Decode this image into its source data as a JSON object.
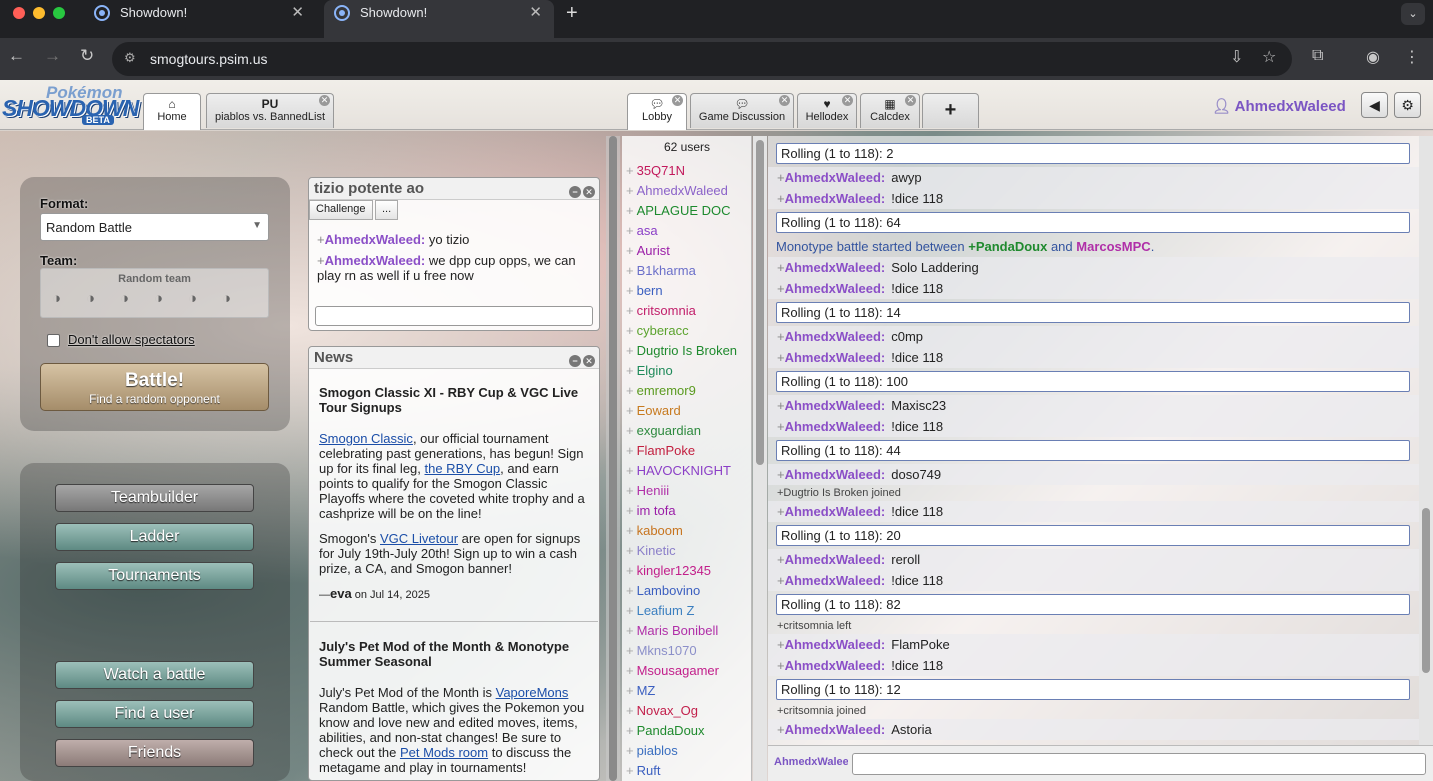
{
  "browser": {
    "tabs": [
      {
        "title": "Showdown!",
        "close": "✕"
      },
      {
        "title": "Showdown!",
        "close": "✕"
      }
    ],
    "new_tab": "+",
    "url": "smogtours.psim.us"
  },
  "header": {
    "logo": {
      "line1": "Pokémon",
      "line2": "SHOWDOWN",
      "badge": "BETA"
    },
    "tabs": [
      {
        "icon": "⌂",
        "label": "Home"
      },
      {
        "title": "PU",
        "label": "piablos vs. BannedList"
      },
      {
        "label": "Lobby"
      },
      {
        "label": "Game Discussion"
      },
      {
        "label": "Hellodex"
      },
      {
        "label": "Calcdex"
      }
    ],
    "add_tab": "+",
    "username": "AhmedxWaleed"
  },
  "mainmenu": {
    "format_label": "Format:",
    "format_value": "Random Battle",
    "team_label": "Team:",
    "team_value": "Random team",
    "spectators_label": "Don't allow spectators",
    "battle_title": "Battle!",
    "battle_sub": "Find a random opponent",
    "buttons": [
      "Teambuilder",
      "Ladder",
      "Tournaments",
      "Watch a battle",
      "Find a user",
      "Friends"
    ]
  },
  "pm": {
    "title": "tizio potente ao",
    "challenge": "Challenge",
    "more": "...",
    "messages": [
      {
        "user": "AhmedxWaleed:",
        "text": "yo tizio"
      },
      {
        "user": "AhmedxWaleed:",
        "text": "we dpp cup opps, we can play rn as well if u free now"
      }
    ]
  },
  "news": {
    "title": "News",
    "items": [
      {
        "title": "Smogon Classic XI - RBY Cup & VGC Live Tour Signups",
        "p1_link": "Smogon Classic",
        "p1_text": ", our official tournament celebrating past generations, has begun! Sign up for its final leg, ",
        "p1_link2": "the RBY Cup",
        "p1_text2": ", and earn points to qualify for the Smogon Classic Playoffs where the coveted white trophy and a cashprize will be on the line!",
        "p2_pre": "Smogon's ",
        "p2_link": "VGC Livetour",
        "p2_text": " are open for signups for July 19th-July 20th! Sign up to win a cash prize, a CA, and Smogon banner!",
        "author": "eva",
        "date": "on Jul 14, 2025"
      },
      {
        "title": "July's Pet Mod of the Month & Monotype Summer Seasonal",
        "p1_pre": "July's Pet Mod of the Month is ",
        "p1_link": "VaporeMons",
        "p1_text": " Random Battle, which gives the Pokemon you know and love new and edited moves, items, abilities, and non-stat changes! Be sure to check out the ",
        "p1_link2": "Pet Mods room",
        "p1_text2": " to discuss the metagame and play in tournaments!"
      }
    ]
  },
  "userlist": {
    "count": "62 users",
    "users": [
      {
        "name": "35Q71N",
        "color": "#c2185b"
      },
      {
        "name": "AhmedxWaleed",
        "color": "#8b62c9"
      },
      {
        "name": "APLAGUE DOC",
        "color": "#1d8a2e"
      },
      {
        "name": "asa",
        "color": "#8b3fc7"
      },
      {
        "name": "Aurist",
        "color": "#9b1fa8"
      },
      {
        "name": "B1kharma",
        "color": "#6b6fc9"
      },
      {
        "name": "bern",
        "color": "#3b5fc0"
      },
      {
        "name": "critsomnia",
        "color": "#c21f6b"
      },
      {
        "name": "cyberacc",
        "color": "#5ba32e"
      },
      {
        "name": "Dugtrio Is Broken",
        "color": "#1f8a2e"
      },
      {
        "name": "Elgino",
        "color": "#1f8a5a"
      },
      {
        "name": "emremor9",
        "color": "#5a9a1f"
      },
      {
        "name": "Eoward",
        "color": "#c77a1f"
      },
      {
        "name": "exguardian",
        "color": "#2e8a3f"
      },
      {
        "name": "FlamPoke",
        "color": "#c21f3f"
      },
      {
        "name": "HAVOCKNIGHT",
        "color": "#8b3fc7"
      },
      {
        "name": "Heniii",
        "color": "#b02fa8"
      },
      {
        "name": "im tofa",
        "color": "#9b1fa8"
      },
      {
        "name": "kaboom",
        "color": "#c7741f"
      },
      {
        "name": "Kinetic",
        "color": "#8b7fc9"
      },
      {
        "name": "kingler12345",
        "color": "#c21f8b"
      },
      {
        "name": "Lambovino",
        "color": "#3b5fc0"
      },
      {
        "name": "Leafium Z",
        "color": "#3b7fc0"
      },
      {
        "name": "Maris Bonibell",
        "color": "#b02fa8"
      },
      {
        "name": "Mkns1070",
        "color": "#8b8fc9"
      },
      {
        "name": "Msousagamer",
        "color": "#c21f8b"
      },
      {
        "name": "MZ",
        "color": "#3b5fc0"
      },
      {
        "name": "Novax_Og",
        "color": "#c21f4b"
      },
      {
        "name": "PandaDoux",
        "color": "#1f8a2e"
      },
      {
        "name": "piablos",
        "color": "#3b6fc0"
      },
      {
        "name": "Ruft",
        "color": "#3b5fc0"
      }
    ]
  },
  "lobby": {
    "monotype": {
      "pre": "Monotype battle started between ",
      "p1": "+PandaDoux",
      "mid": " and ",
      "p2": "MarcosMPC",
      "post": "."
    },
    "lines": [
      {
        "kind": "roll",
        "text": "Rolling (1 to 118): 2"
      },
      {
        "kind": "msg",
        "user": "AhmedxWaleed:",
        "text": "awyp"
      },
      {
        "kind": "msg",
        "user": "AhmedxWaleed:",
        "text": "!dice 118"
      },
      {
        "kind": "roll",
        "text": "Rolling (1 to 118): 64"
      },
      {
        "kind": "msg",
        "user": "AhmedxWaleed:",
        "text": "Solo Laddering"
      },
      {
        "kind": "msg",
        "user": "AhmedxWaleed:",
        "text": "!dice 118"
      },
      {
        "kind": "roll",
        "text": "Rolling (1 to 118): 14"
      },
      {
        "kind": "msg",
        "user": "AhmedxWaleed:",
        "text": "c0mp"
      },
      {
        "kind": "msg",
        "user": "AhmedxWaleed:",
        "text": "!dice 118"
      },
      {
        "kind": "roll",
        "text": "Rolling (1 to 118): 100"
      },
      {
        "kind": "msg",
        "user": "AhmedxWaleed:",
        "text": "Maxisc23"
      },
      {
        "kind": "msg",
        "user": "AhmedxWaleed:",
        "text": "!dice 118"
      },
      {
        "kind": "roll",
        "text": "Rolling (1 to 118): 44"
      },
      {
        "kind": "msg",
        "user": "AhmedxWaleed:",
        "text": "doso749"
      },
      {
        "kind": "join",
        "text": "+Dugtrio Is Broken joined"
      },
      {
        "kind": "msg",
        "user": "AhmedxWaleed:",
        "text": "!dice 118"
      },
      {
        "kind": "roll",
        "text": "Rolling (1 to 118): 20"
      },
      {
        "kind": "msg",
        "user": "AhmedxWaleed:",
        "text": "reroll"
      },
      {
        "kind": "msg",
        "user": "AhmedxWaleed:",
        "text": "!dice 118"
      },
      {
        "kind": "roll",
        "text": "Rolling (1 to 118): 82"
      },
      {
        "kind": "join",
        "text": "+critsomnia left"
      },
      {
        "kind": "msg",
        "user": "AhmedxWaleed:",
        "text": "FlamPoke"
      },
      {
        "kind": "msg",
        "user": "AhmedxWaleed:",
        "text": "!dice 118"
      },
      {
        "kind": "roll",
        "text": "Rolling (1 to 118): 12"
      },
      {
        "kind": "join",
        "text": "+critsomnia joined"
      },
      {
        "kind": "msg",
        "user": "AhmedxWaleed:",
        "text": "Astoria"
      }
    ],
    "input_name": "AhmedxWaleed"
  },
  "colors": {
    "accent": "#8b4fc7",
    "roll_border": "#6a7fb4"
  }
}
